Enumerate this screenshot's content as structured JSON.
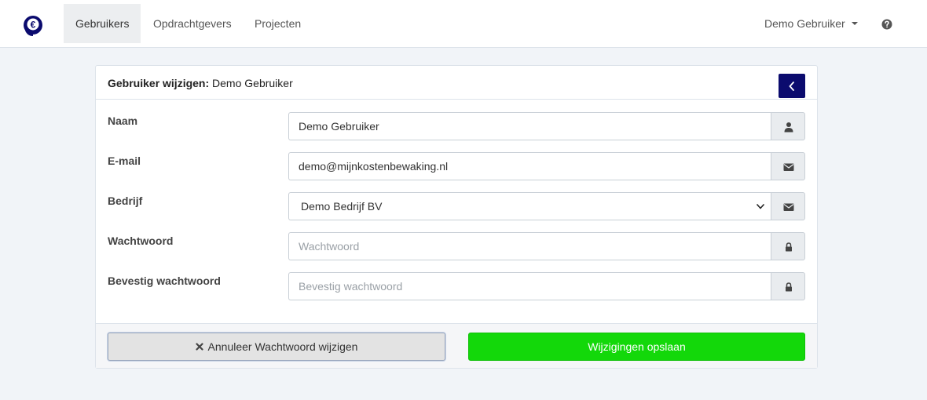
{
  "nav": {
    "items": [
      {
        "label": "Gebruikers",
        "active": true
      },
      {
        "label": "Opdrachtgevers",
        "active": false
      },
      {
        "label": "Projecten",
        "active": false
      }
    ],
    "user_label": "Demo Gebruiker",
    "logo_icon": "euro-logo-icon",
    "help_icon": "question-circle-icon"
  },
  "card": {
    "title_prefix": "Gebruiker wijzigen:",
    "title_name": "Demo Gebruiker",
    "back_icon": "chevron-left-icon"
  },
  "form": {
    "name": {
      "label": "Naam",
      "value": "Demo Gebruiker",
      "icon": "user-icon"
    },
    "email": {
      "label": "E-mail",
      "value": "demo@mijnkostenbewaking.nl",
      "icon": "envelope-icon"
    },
    "company": {
      "label": "Bedrijf",
      "selected": "Demo Bedrijf BV",
      "icon": "envelope-icon"
    },
    "password": {
      "label": "Wachtwoord",
      "placeholder": "Wachtwoord",
      "icon": "lock-icon"
    },
    "confirm_password": {
      "label": "Bevestig wachtwoord",
      "placeholder": "Bevestig wachtwoord",
      "icon": "lock-icon"
    }
  },
  "footer": {
    "cancel_label": "Annuleer Wachtwoord wijzigen",
    "cancel_icon": "times-icon",
    "save_label": "Wijzigingen opslaan"
  },
  "colors": {
    "primary_dark": "#0b0b6e",
    "save_green": "#13d80a",
    "page_bg": "#f1f4f8"
  }
}
